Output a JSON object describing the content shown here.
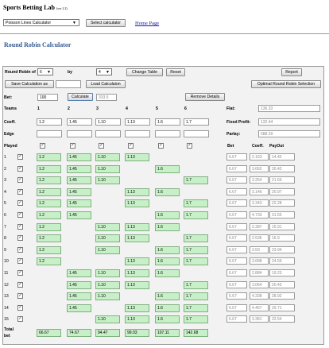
{
  "brand": {
    "title": "Sports Betting Lab",
    "version": "(ver 2.2)"
  },
  "calculator_select": "Poisson Lines Calculator",
  "select_button": "Select calculator",
  "home_link": "Home Page",
  "page_title": "Round Robin Calculator",
  "controls": {
    "rr_label": "Round Robin of",
    "rr_value": "6",
    "by_label": "by",
    "by_value": "4",
    "change_table": "Change Table",
    "reset": "Reset",
    "report": "Report",
    "save_calc": "Save Calculation as",
    "load_calc": "Load Calculaion",
    "optimal": "Optimal Round Robin Selection"
  },
  "bet": {
    "label": "Bet:",
    "value": "100",
    "calculate": "Calculate",
    "result": "333.5",
    "remove": "Remove Details"
  },
  "teams_label": "Teams",
  "teams": [
    "1",
    "2",
    "3",
    "4",
    "5",
    "6"
  ],
  "coeff_label": "Coeff.",
  "coeffs": [
    "1.2",
    "1.45",
    "1.10",
    "1.13",
    "1.6",
    "1.7"
  ],
  "edge_label": "Edge",
  "played_label": "Played",
  "summary": {
    "flat_label": "Flat:",
    "flat_value": "136.33",
    "fixed_label": "Fixed Profit:",
    "fixed_value": "132.44",
    "parlay_label": "Parlay:",
    "parlay_value": "588.29"
  },
  "headers": {
    "bet": "Bet",
    "coeff": "Coeff.",
    "payout": "PayOut"
  },
  "rows": [
    {
      "n": "1",
      "cells": [
        "1.2",
        "1.45",
        "1.10",
        "1.13",
        "",
        ""
      ],
      "bet": "6.67",
      "coeff": "2.163",
      "payout": "14.42"
    },
    {
      "n": "2",
      "cells": [
        "1.2",
        "1.45",
        "1.10",
        "",
        "1.6",
        ""
      ],
      "bet": "6.67",
      "coeff": "3.062",
      "payout": "20.42"
    },
    {
      "n": "3",
      "cells": [
        "1.2",
        "1.45",
        "1.10",
        "",
        "",
        "1.7"
      ],
      "bet": "6.67",
      "coeff": "3.254",
      "payout": "21.69"
    },
    {
      "n": "4",
      "cells": [
        "1.2",
        "1.45",
        "",
        "1.13",
        "1.6",
        ""
      ],
      "bet": "6.67",
      "coeff": "3.146",
      "payout": "20.97"
    },
    {
      "n": "5",
      "cells": [
        "1.2",
        "1.45",
        "",
        "1.13",
        "",
        "1.7"
      ],
      "bet": "6.67",
      "coeff": "3.343",
      "payout": "22.28"
    },
    {
      "n": "6",
      "cells": [
        "1.2",
        "1.45",
        "",
        "",
        "1.6",
        "1.7"
      ],
      "bet": "6.67",
      "coeff": "4.733",
      "payout": "31.55"
    },
    {
      "n": "7",
      "cells": [
        "1.2",
        "",
        "1.10",
        "1.13",
        "1.6",
        ""
      ],
      "bet": "6.67",
      "coeff": "2.387",
      "payout": "15.91"
    },
    {
      "n": "8",
      "cells": [
        "1.2",
        "",
        "1.10",
        "1.13",
        "",
        "1.7"
      ],
      "bet": "6.67",
      "coeff": "2.536",
      "payout": "16.9"
    },
    {
      "n": "9",
      "cells": [
        "1.2",
        "",
        "1.10",
        "",
        "1.6",
        "1.7"
      ],
      "bet": "6.67",
      "coeff": "3.59",
      "payout": "23.94"
    },
    {
      "n": "10",
      "cells": [
        "1.2",
        "",
        "",
        "1.13",
        "1.6",
        "1.7"
      ],
      "bet": "6.67",
      "coeff": "3.688",
      "payout": "24.59"
    },
    {
      "n": "11",
      "cells": [
        "",
        "1.45",
        "1.10",
        "1.13",
        "1.6",
        ""
      ],
      "bet": "6.67",
      "coeff": "2.884",
      "payout": "19.23"
    },
    {
      "n": "12",
      "cells": [
        "",
        "1.45",
        "1.10",
        "1.13",
        "",
        "1.7"
      ],
      "bet": "6.67",
      "coeff": "3.064",
      "payout": "20.43"
    },
    {
      "n": "13",
      "cells": [
        "",
        "1.45",
        "1.10",
        "",
        "1.6",
        "1.7"
      ],
      "bet": "6.67",
      "coeff": "4.338",
      "payout": "28.92"
    },
    {
      "n": "14",
      "cells": [
        "",
        "1.45",
        "",
        "1.13",
        "1.6",
        "1.7"
      ],
      "bet": "6.67",
      "coeff": "4.457",
      "payout": "29.71"
    },
    {
      "n": "15",
      "cells": [
        "",
        "",
        "1.10",
        "1.13",
        "1.6",
        "1.7"
      ],
      "bet": "6.67",
      "coeff": "3.381",
      "payout": "22.54"
    }
  ],
  "total": {
    "label1": "Total",
    "label2": "bet",
    "values": [
      "66.67",
      "74.67",
      "94.47",
      "99.03",
      "107.11",
      "142.68"
    ]
  }
}
